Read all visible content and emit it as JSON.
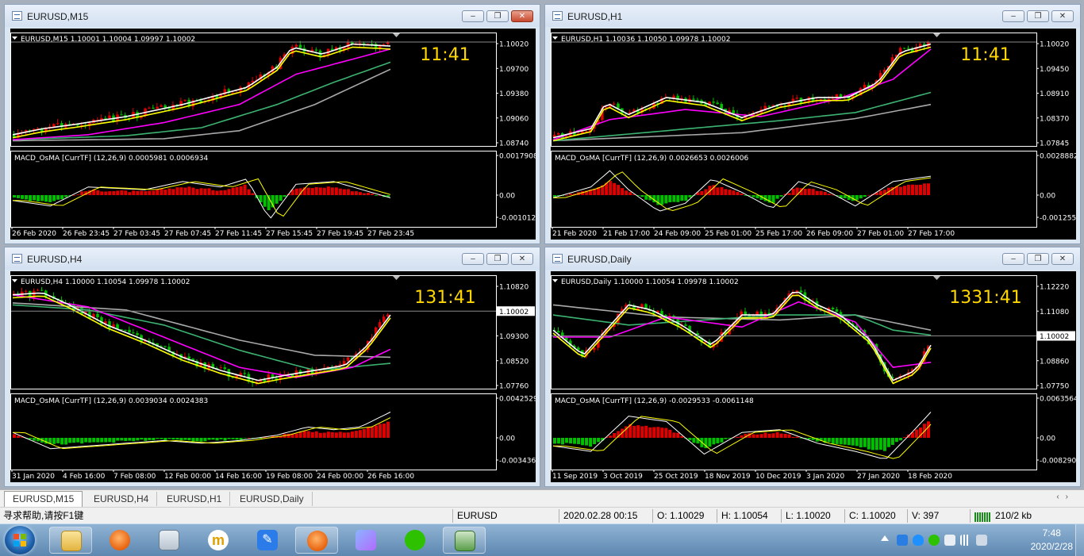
{
  "windows": [
    {
      "id": "m15",
      "title": "EURUSD,M15",
      "active": true,
      "info": "EURUSD,M15  1.10001 1.10004 1.09997 1.10002",
      "clock": "11:41",
      "current_price": "1.10002",
      "price_axis": [
        "1.10020",
        "1.09700",
        "1.09380",
        "1.09060",
        "1.08740"
      ],
      "macd_label": "MACD_OsMA [CurrTF] (12,26,9) 0.0005981 0.0006934",
      "macd_axis": [
        "0.0017908",
        "0.00",
        "-0.0010122"
      ],
      "time_axis": [
        "26 Feb 2020",
        "26 Feb 23:45",
        "27 Feb 03:45",
        "27 Feb 07:45",
        "27 Feb 11:45",
        "27 Feb 15:45",
        "27 Feb 19:45",
        "27 Feb 23:45"
      ]
    },
    {
      "id": "h1",
      "title": "EURUSD,H1",
      "active": false,
      "info": "EURUSD,H1  1.10036 1.10050 1.09978 1.10002",
      "clock": "11:41",
      "current_price": "1.10002",
      "price_axis": [
        "1.10020",
        "1.09450",
        "1.08910",
        "1.08370",
        "1.07845"
      ],
      "macd_label": "MACD_OsMA [CurrTF] (12,26,9) 0.0026653 0.0026006",
      "macd_axis": [
        "0.0028882",
        "0.00",
        "-0.0012559"
      ],
      "time_axis": [
        "21 Feb 2020",
        "21 Feb 17:00",
        "24 Feb 09:00",
        "25 Feb 01:00",
        "25 Feb 17:00",
        "26 Feb 09:00",
        "27 Feb 01:00",
        "27 Feb 17:00"
      ]
    },
    {
      "id": "h4",
      "title": "EURUSD,H4",
      "active": false,
      "info": "EURUSD,H4  1.10000 1.10054 1.09978 1.10002",
      "clock": "131:41",
      "current_price": "1.10002",
      "price_axis": [
        "1.10820",
        "1.10002",
        "1.09300",
        "1.08520",
        "1.07760"
      ],
      "macd_label": "MACD_OsMA [CurrTF] (12,26,9) 0.0039034 0.0024383",
      "macd_axis": [
        "0.0042529",
        "0.00",
        "-0.0034363"
      ],
      "time_axis": [
        "31 Jan 2020",
        "4 Feb 16:00",
        "7 Feb 08:00",
        "12 Feb 00:00",
        "14 Feb 16:00",
        "19 Feb 08:00",
        "24 Feb 00:00",
        "26 Feb 16:00"
      ]
    },
    {
      "id": "d1",
      "title": "EURUSD,Daily",
      "active": false,
      "info": "EURUSD,Daily  1.10000 1.10054 1.09978 1.10002",
      "clock": "1331:41",
      "current_price": "1.10002",
      "price_axis": [
        "1.12220",
        "1.11080",
        "1.10002",
        "1.08860",
        "1.07750"
      ],
      "macd_label": "MACD_OsMA [CurrTF] (12,26,9) -0.0029533 -0.0061148",
      "macd_axis": [
        "0.0063564",
        "0.00",
        "-0.0082905"
      ],
      "time_axis": [
        "11 Sep 2019",
        "3 Oct 2019",
        "25 Oct 2019",
        "18 Nov 2019",
        "10 Dec 2019",
        "3 Jan 2020",
        "27 Jan 2020",
        "18 Feb 2020"
      ]
    }
  ],
  "tabs": [
    "EURUSD,M15",
    "EURUSD,H4",
    "EURUSD,H1",
    "EURUSD,Daily"
  ],
  "status": {
    "help": "寻求帮助,请按F1键",
    "symbol": "EURUSD",
    "datetime": "2020.02.28 00:15",
    "open": "O: 1.10029",
    "high": "H: 1.10054",
    "low": "L: 1.10020",
    "close": "C: 1.10020",
    "volume": "V: 397",
    "traffic": "210/2 kb"
  },
  "taskbar": {
    "time": "7:48",
    "date": "2020/2/28"
  },
  "colors": {
    "bull": "#00c000",
    "bear": "#e00000",
    "ma_white": "#ffffff",
    "ma_yellow": "#ffff00",
    "ma_magenta": "#ff00ff",
    "ma_green": "#3cb371",
    "ma_gray": "#a9a9a9",
    "clock": "#ffd700"
  }
}
